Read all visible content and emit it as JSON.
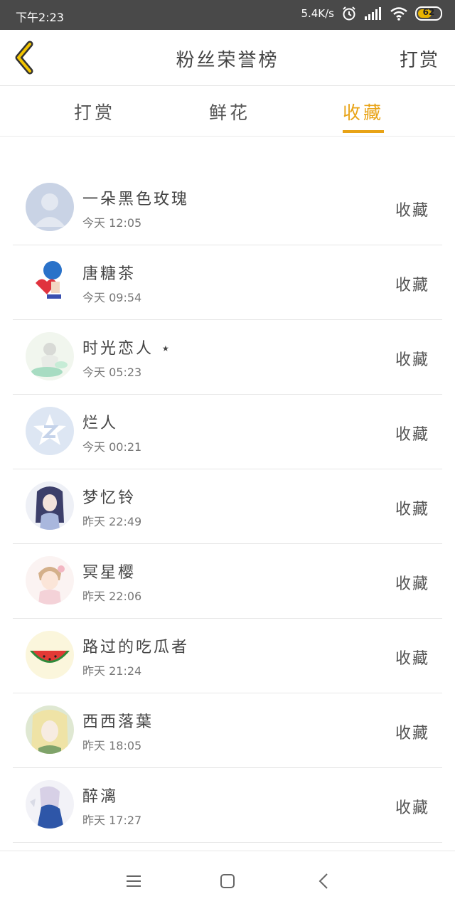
{
  "status_bar": {
    "time": "下午2:23",
    "speed": "5.4K/s",
    "battery": "62",
    "battery_level": 0.62,
    "icons": [
      "alarm-icon",
      "signal-icon",
      "wifi-icon",
      "battery-icon"
    ]
  },
  "header": {
    "title": "粉丝荣誉榜",
    "action_label": "打赏",
    "back_icon": "chevron-left-icon"
  },
  "tabs": [
    {
      "label": "打赏",
      "active": false
    },
    {
      "label": "鲜花",
      "active": false
    },
    {
      "label": "收藏",
      "active": true
    }
  ],
  "accent_color": "#e8a316",
  "list": [
    {
      "name": "一朵黑色玫瑰",
      "time": "今天 12:05",
      "badge": "收藏"
    },
    {
      "name": "唐糖茶",
      "time": "今天 09:54",
      "badge": "收藏"
    },
    {
      "name": "时光恋人 ⋆",
      "time": "今天 05:23",
      "badge": "收藏"
    },
    {
      "name": "烂人",
      "time": "今天 00:21",
      "badge": "收藏"
    },
    {
      "name": "梦忆铃",
      "time": "昨天 22:49",
      "badge": "收藏"
    },
    {
      "name": "冥星樱",
      "time": "昨天 22:06",
      "badge": "收藏"
    },
    {
      "name": "路过的吃瓜者",
      "time": "昨天 21:24",
      "badge": "收藏"
    },
    {
      "name": "西西落葉",
      "time": "昨天 18:05",
      "badge": "收藏"
    },
    {
      "name": "醉漓",
      "time": "昨天 17:27",
      "badge": "收藏"
    }
  ],
  "system_nav": [
    "menu-icon",
    "home-icon",
    "back-icon"
  ]
}
